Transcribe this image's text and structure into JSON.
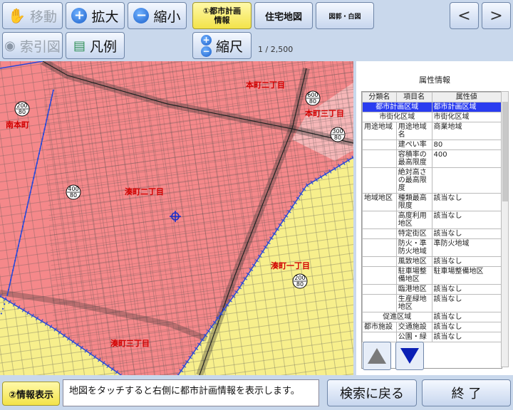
{
  "toolbar": {
    "move_label": "移動",
    "zoom_in_label": "拡大",
    "zoom_out_label": "縮小",
    "urban_plan_label_line1": "①都市計画",
    "urban_plan_label_line2": "情報",
    "housing_map_label": "住宅地図",
    "zumen_label": "図郭・白図",
    "prev_label": "<",
    "next_label": ">",
    "index_map_label": "索引図",
    "legend_label": "凡例",
    "scale_label": "縮尺",
    "scale_value": "1 / 2,500"
  },
  "map": {
    "labels": [
      "本町二丁目",
      "南本町",
      "本町三丁目",
      "湊町二丁目",
      "湊町一丁目",
      "湊町三丁目"
    ],
    "zone_markers": [
      {
        "top": "200",
        "bottom": "80"
      },
      {
        "top": "600",
        "bottom": "80"
      },
      {
        "top": "300",
        "bottom": "80"
      },
      {
        "top": "400",
        "bottom": "80"
      },
      {
        "top": "200",
        "bottom": "80"
      }
    ]
  },
  "panel": {
    "title": "属性情報",
    "columns": [
      "分類名",
      "項目名",
      "属性値"
    ],
    "rows": [
      {
        "cat": "都市計画区域",
        "item": "",
        "value": "都市計画区域",
        "selected": true,
        "merged": true
      },
      {
        "cat": "市街化区域",
        "item": "",
        "value": "市街化区域",
        "merged": true
      },
      {
        "cat": "用途地域",
        "item": "用途地域名",
        "value": "商業地域"
      },
      {
        "cat": "",
        "item": "建ぺい率",
        "value": "80"
      },
      {
        "cat": "",
        "item": "容積率の最高限度",
        "value": "400"
      },
      {
        "cat": "",
        "item": "絶対高さの最高限度",
        "value": ""
      },
      {
        "cat": "地域地区",
        "item": "種類最高限度",
        "value": "該当なし"
      },
      {
        "cat": "",
        "item": "高度利用地区",
        "value": "該当なし"
      },
      {
        "cat": "",
        "item": "特定街区",
        "value": "該当なし"
      },
      {
        "cat": "",
        "item": "防火・準防火地域",
        "value": "準防火地域"
      },
      {
        "cat": "",
        "item": "風致地区",
        "value": "該当なし"
      },
      {
        "cat": "",
        "item": "駐車場整備地区",
        "value": "駐車場整備地区"
      },
      {
        "cat": "",
        "item": "臨港地区",
        "value": "該当なし"
      },
      {
        "cat": "",
        "item": "生産緑地地区",
        "value": "該当なし"
      },
      {
        "cat": "促進区域",
        "item": "",
        "value": "該当なし",
        "merged": true
      },
      {
        "cat": "都市施設",
        "item": "交通施設",
        "value": "該当なし"
      },
      {
        "cat": "",
        "item": "公園・緑",
        "value": "該当なし"
      }
    ]
  },
  "bottom": {
    "info_display_label": "②情報表示",
    "message": "地図をタッチすると右側に都市計画情報を表示します。",
    "back_to_search_label": "検索に戻る",
    "end_label": "終 了"
  },
  "colors": {
    "commercial_zone": "#f5888a",
    "residential_zone": "#f7ef8c",
    "selection": "#2a3cf0",
    "boundary": "#2848d8"
  }
}
